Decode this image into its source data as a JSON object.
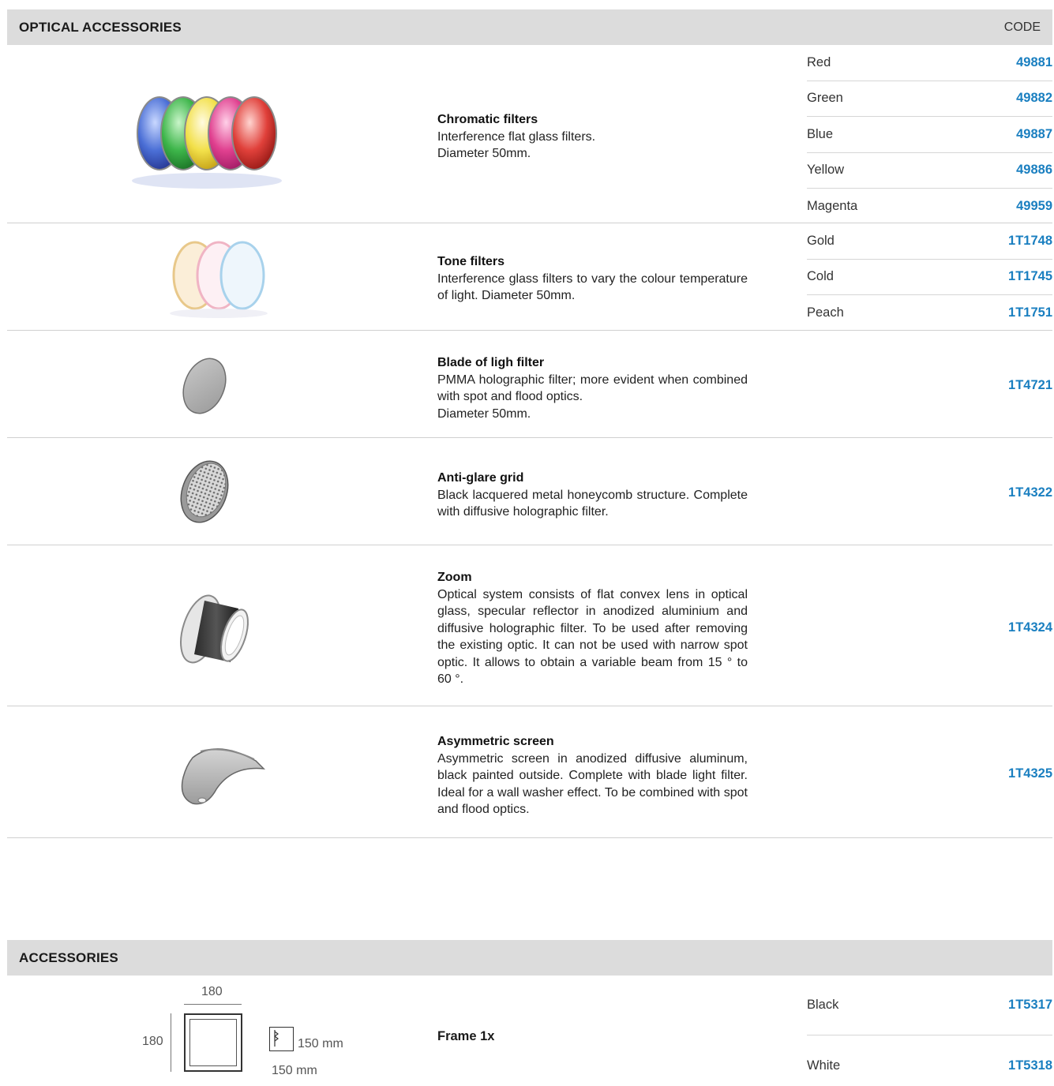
{
  "optical": {
    "title": "OPTICAL ACCESSORIES",
    "code_label": "CODE",
    "items": [
      {
        "name": "Chromatic filters",
        "description": "Interference flat glass filters.\nDiameter 50mm.",
        "variants": [
          {
            "label": "Red",
            "code": "49881"
          },
          {
            "label": "Green",
            "code": "49882"
          },
          {
            "label": "Blue",
            "code": "49887"
          },
          {
            "label": "Yellow",
            "code": "49886"
          },
          {
            "label": "Magenta",
            "code": "49959"
          }
        ]
      },
      {
        "name": "Tone filters",
        "description": "Interference glass filters to vary the colour temperature of light. Diameter 50mm.",
        "variants": [
          {
            "label": "Gold",
            "code": "1T1748"
          },
          {
            "label": "Cold",
            "code": "1T1745"
          },
          {
            "label": "Peach",
            "code": "1T1751"
          }
        ]
      },
      {
        "name": "Blade of ligh filter",
        "description": "PMMA holographic filter; more evident when combined with spot and flood optics.\nDiameter 50mm.",
        "code": "1T4721"
      },
      {
        "name": "Anti-glare grid",
        "description": "Black lacquered metal honeycomb structure. Complete with diffusive holographic filter.",
        "code": "1T4322"
      },
      {
        "name": "Zoom",
        "description": "Optical system consists of flat convex lens  in optical glass, specular reflector in anodized aluminium and diffusive holographic filter. To be used after removing the existing optic.  It can not be used with narrow spot optic. It allows to obtain a variable beam from 15 ° to 60 °.",
        "code": "1T4324"
      },
      {
        "name": "Asymmetric screen",
        "description": "Asymmetric screen in anodized diffusive aluminum, black painted outside. Complete with blade light filter. Ideal for a wall washer effect. To be combined with spot and flood optics.",
        "code": "1T4325"
      }
    ]
  },
  "accessories": {
    "title": "ACCESSORIES",
    "frame": {
      "name": "Frame 1x",
      "dim_width": "180",
      "dim_height": "180",
      "cutout_height": "150 mm",
      "cutout_width": "150 mm",
      "variants": [
        {
          "label": "Black",
          "code": "1T5317"
        },
        {
          "label": "White",
          "code": "1T5318"
        }
      ]
    }
  },
  "colors": {
    "header_bg": "#dcdcdc",
    "code_blue": "#1a7fc0"
  }
}
